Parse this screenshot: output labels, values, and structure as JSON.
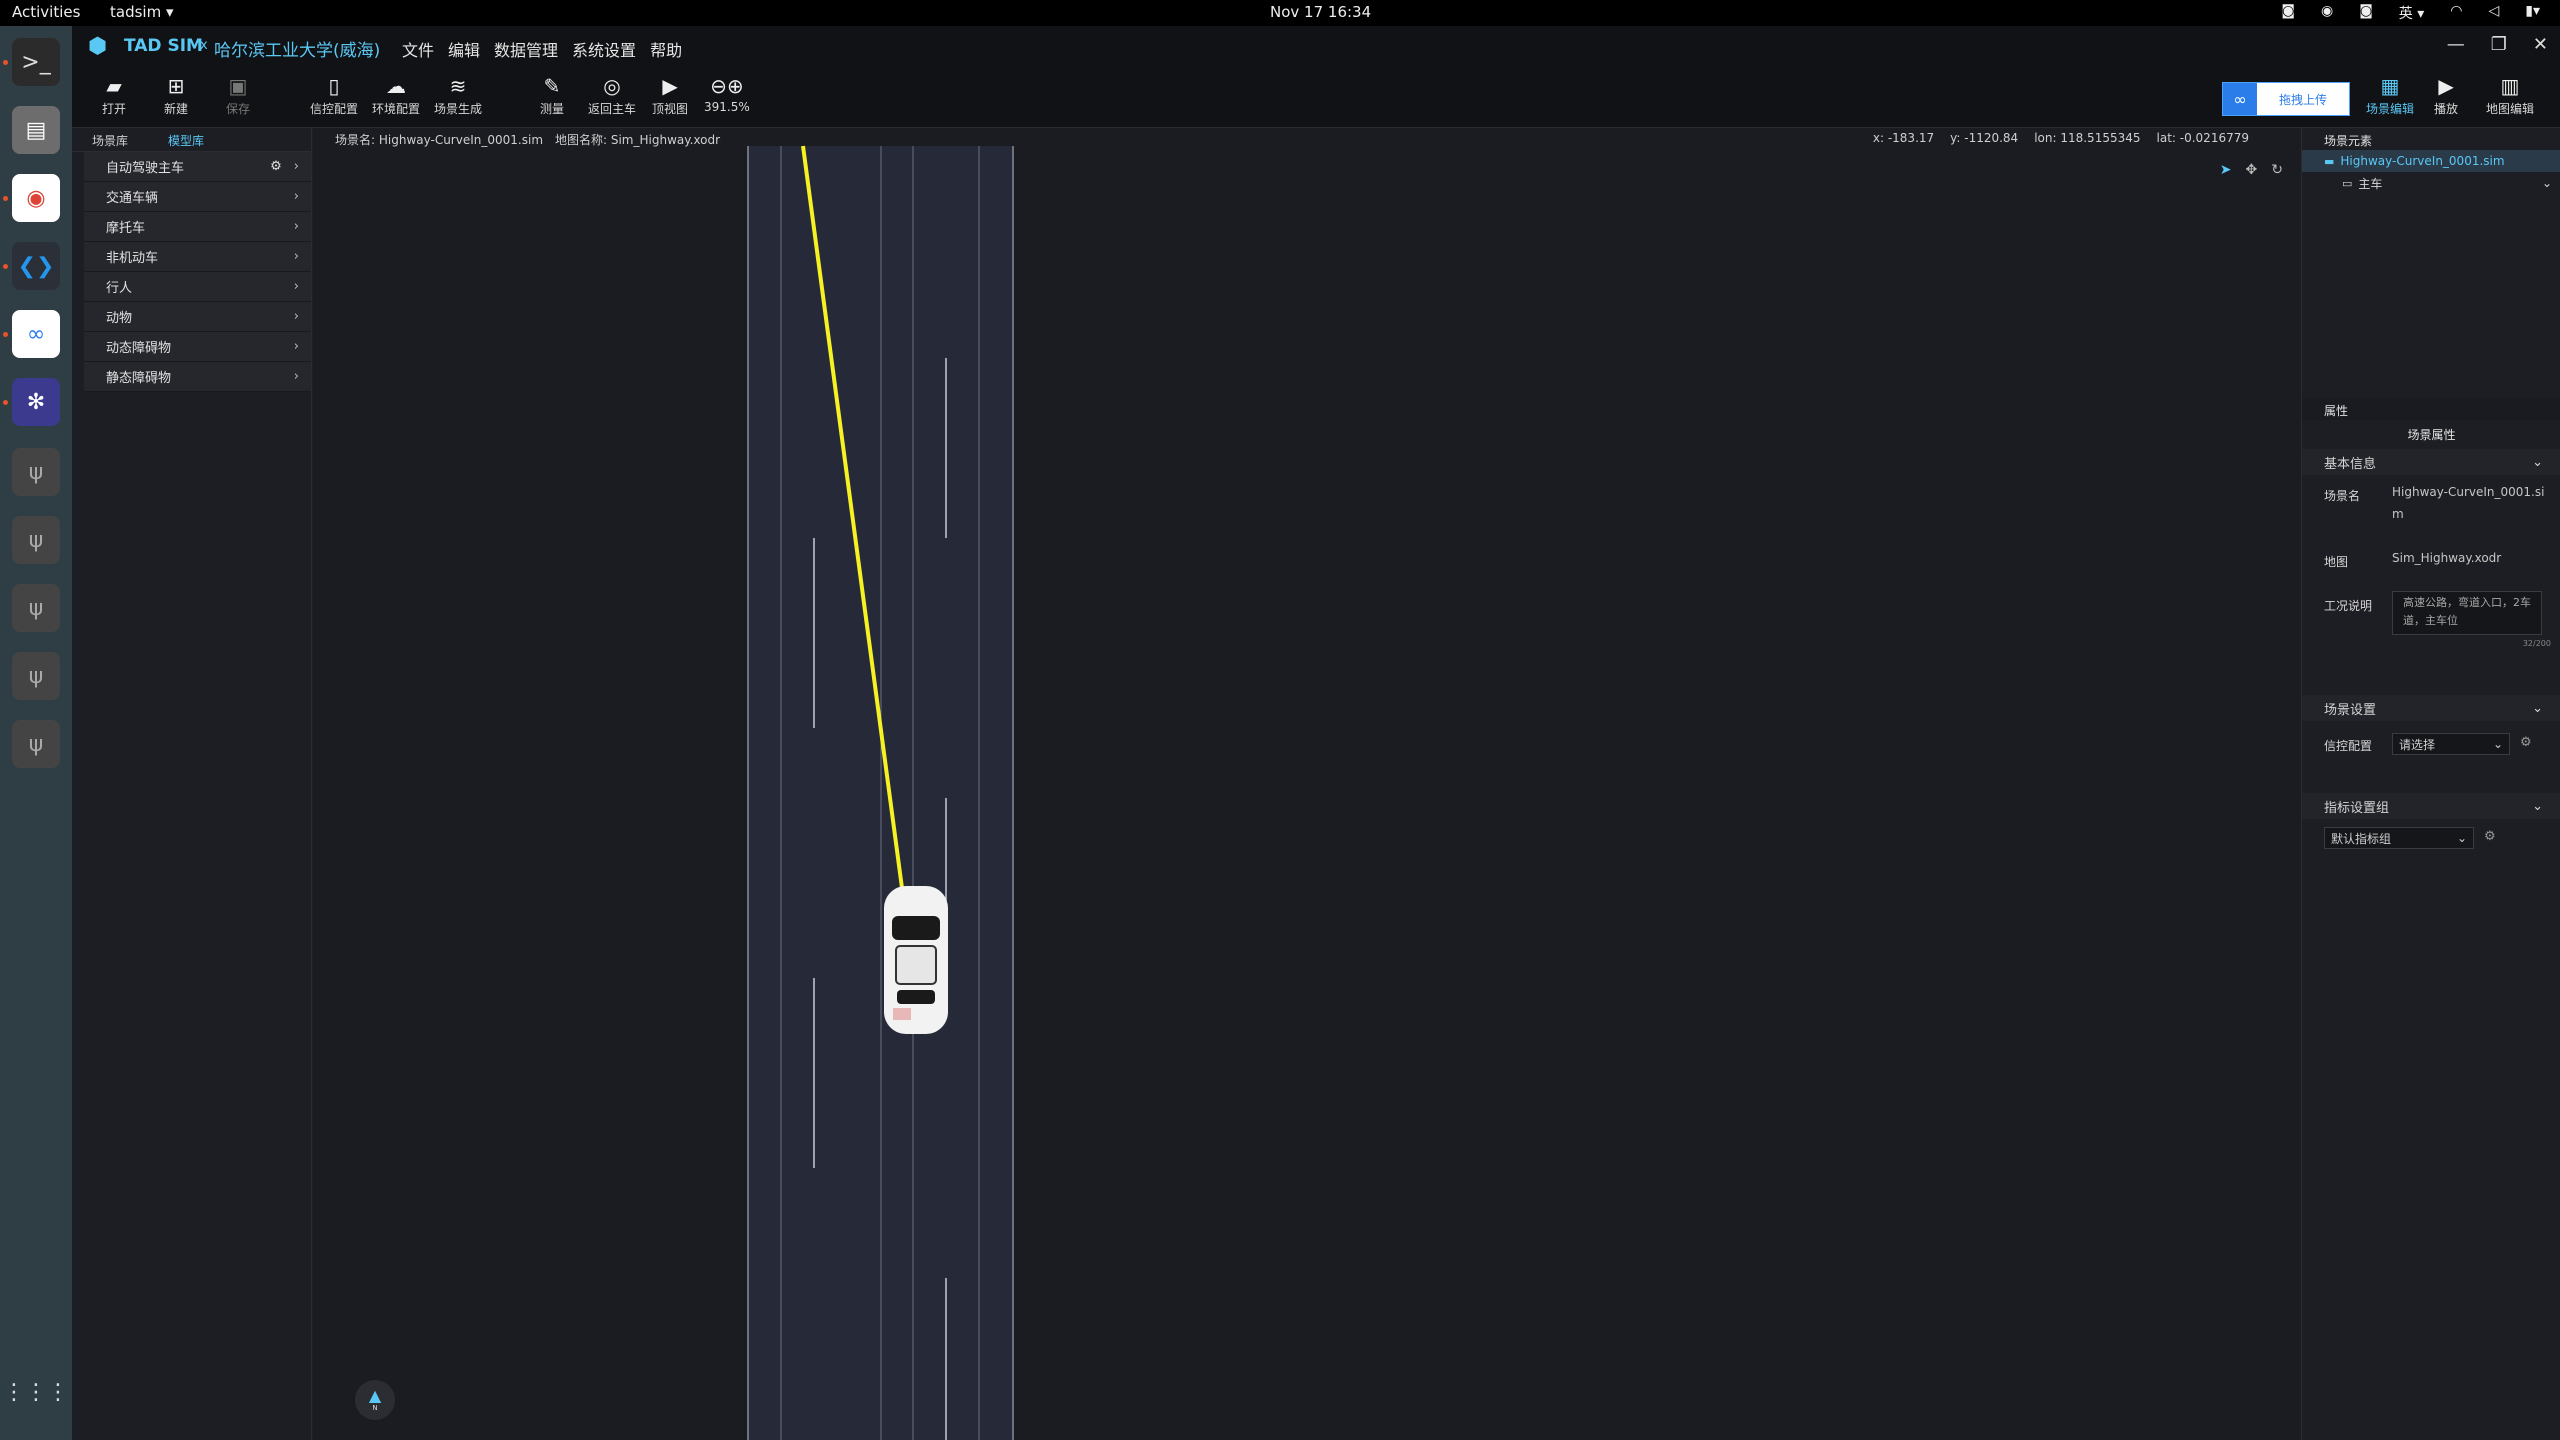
{
  "system_bar": {
    "activities": "Activities",
    "app": "tadsim ▾",
    "clock": "Nov 17  16:34",
    "input_method": "英 ▾"
  },
  "dock": [
    {
      "name": "terminal",
      "glyph": ">_"
    },
    {
      "name": "files",
      "glyph": "▤"
    },
    {
      "name": "chrome",
      "glyph": "◉"
    },
    {
      "name": "vscode",
      "glyph": "❮❯"
    },
    {
      "name": "baidunetdisk",
      "glyph": "∞"
    },
    {
      "name": "tadsim",
      "glyph": "✻"
    },
    {
      "name": "usb1",
      "glyph": "ψ"
    },
    {
      "name": "usb2",
      "glyph": "ψ"
    },
    {
      "name": "usb3",
      "glyph": "ψ"
    },
    {
      "name": "usb4",
      "glyph": "ψ"
    },
    {
      "name": "usb5",
      "glyph": "ψ"
    },
    {
      "name": "apps",
      "glyph": "⋮⋮⋮"
    }
  ],
  "title": {
    "brand": "TAD SIM",
    "x": "x",
    "school": "哈尔滨工业大学(威海)"
  },
  "menu": [
    "文件",
    "编辑",
    "数据管理",
    "系统设置",
    "帮助"
  ],
  "toolbar": {
    "open": "打开",
    "new": "新建",
    "save": "保存",
    "signal": "信控配置",
    "env": "环境配置",
    "scene_gen": "场景生成",
    "measure": "测量",
    "return_ego": "返回主车",
    "top_view": "顶视图",
    "zoom": "391.5%",
    "scene_edit": "场景编辑",
    "play": "播放",
    "map_edit": "地图编辑",
    "upload": "拖拽上传"
  },
  "left": {
    "tabs": [
      "场景库",
      "模型库"
    ],
    "active_tab": 1,
    "categories": [
      "自动驾驶主车",
      "交通车辆",
      "摩托车",
      "非机动车",
      "行人",
      "动物",
      "动态障碍物",
      "静态障碍物"
    ]
  },
  "viewport": {
    "scene_name": "场景名: Highway-CurveIn_0001.sim",
    "map_name": "地图名称: Sim_Highway.xodr",
    "x": "x: -183.17",
    "y": "y: -1120.84",
    "lon": "lon: 118.5155345",
    "lat": "lat: -0.0216779",
    "compass": "N"
  },
  "right": {
    "elements_title": "场景元素",
    "tree_file": "Highway-CurveIn_0001.sim",
    "tree_ego": "主车",
    "props_title": "属性",
    "scene_props": "场景属性",
    "basic_info": "基本信息",
    "scene_name_label": "场景名",
    "scene_name_value": "Highway-CurveIn_0001.sim",
    "map_label": "地图",
    "map_value": "Sim_Highway.xodr",
    "desc_label": "工况说明",
    "desc_value": "高速公路，弯道入口，2车道，主车位",
    "desc_count": "32/200",
    "scene_settings": "场景设置",
    "signal_label": "信控配置",
    "signal_select": "请选择",
    "metric_group": "指标设置组",
    "metric_select": "默认指标组"
  },
  "colors": {
    "accent": "#5ac8f5",
    "trajectory": "#f5f122",
    "road": "#262938"
  }
}
